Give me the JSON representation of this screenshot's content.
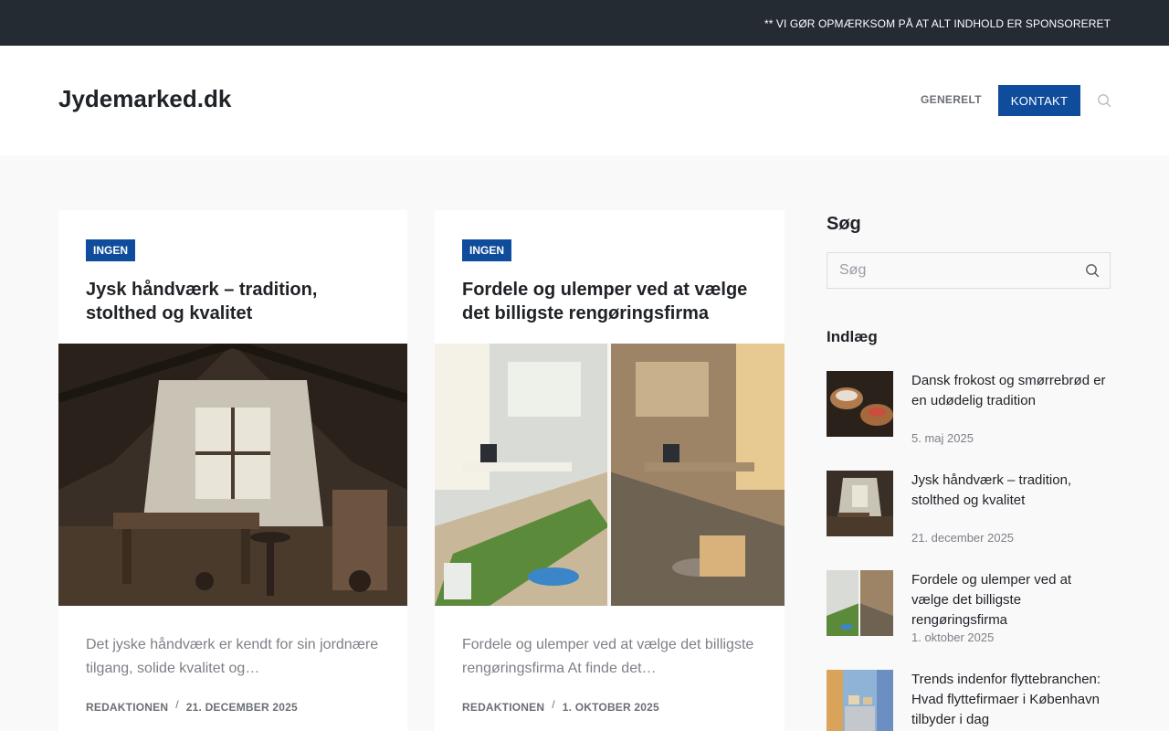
{
  "topbar": {
    "notice": "** VI GØR OPMÆRKSOM PÅ AT ALT INDHOLD ER SPONSORERET"
  },
  "header": {
    "site_title": "Jydemarked.dk",
    "nav": {
      "generelt": "GENERELT",
      "kontakt": "KONTAKT"
    },
    "search_icon": "search-icon"
  },
  "colors": {
    "accent": "#0f4c9c",
    "topbar": "#242b33",
    "page_bg": "#f9f9fa"
  },
  "posts": [
    {
      "category": "INGEN",
      "title": "Jysk håndværk – tradition, stolthed og kvalitet",
      "excerpt": "Det jyske håndværk er kendt for sin jordnære tilgang, solide kvalitet og…",
      "author": "REDAKTIONEN",
      "date": "21. DECEMBER 2025"
    },
    {
      "category": "INGEN",
      "title": "Fordele og ulemper ved at vælge det billigste rengøringsfirma",
      "excerpt": "Fordele og ulemper ved at vælge det billigste rengøringsfirma At finde det…",
      "author": "REDAKTIONEN",
      "date": "1. OKTOBER 2025"
    }
  ],
  "sidebar": {
    "search": {
      "title": "Søg",
      "placeholder": "Søg"
    },
    "recent": {
      "title": "Indlæg",
      "items": [
        {
          "title": "Dansk frokost og smørrebrød er en udødelig tradition",
          "date": "5. maj 2025"
        },
        {
          "title": "Jysk håndværk – tradition, stolthed og kvalitet",
          "date": "21. december 2025"
        },
        {
          "title": "Fordele og ulemper ved at vælge det billigste rengøringsfirma",
          "date": "1. oktober 2025"
        },
        {
          "title": "Trends indenfor flyttebranchen: Hvad flyttefirmaer i København tilbyder i dag",
          "date": ""
        }
      ]
    }
  }
}
